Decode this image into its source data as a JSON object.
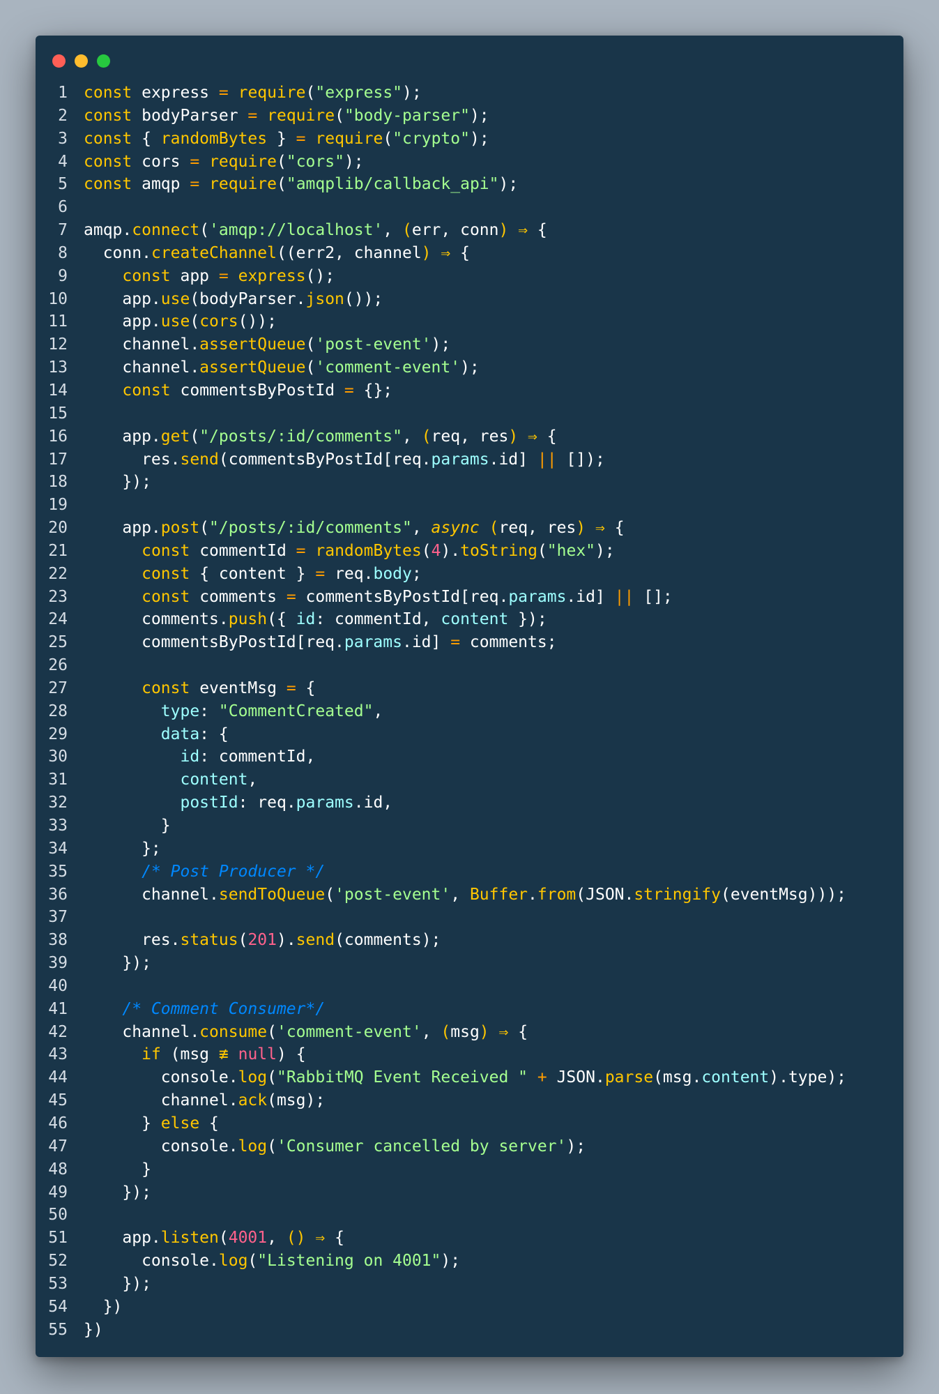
{
  "window": {
    "dot_colors": [
      "#ff5f56",
      "#ffbd2e",
      "#27c93f"
    ]
  },
  "theme": {
    "background": "#193549",
    "keyword": "#ffc600",
    "string": "#a5ff90",
    "property": "#9effff",
    "number": "#ff628c",
    "operator": "#ff9d00",
    "comment": "#0088ff"
  },
  "lines": [
    [
      [
        "k",
        "const"
      ],
      [
        "w",
        " express "
      ],
      [
        "o",
        "="
      ],
      [
        "w",
        " "
      ],
      [
        "f",
        "require"
      ],
      [
        "w",
        "("
      ],
      [
        "s",
        "\"express\""
      ],
      [
        "w",
        ");"
      ]
    ],
    [
      [
        "k",
        "const"
      ],
      [
        "w",
        " bodyParser "
      ],
      [
        "o",
        "="
      ],
      [
        "w",
        " "
      ],
      [
        "f",
        "require"
      ],
      [
        "w",
        "("
      ],
      [
        "s",
        "\"body-parser\""
      ],
      [
        "w",
        ");"
      ]
    ],
    [
      [
        "k",
        "const"
      ],
      [
        "w",
        " { "
      ],
      [
        "k",
        "randomBytes"
      ],
      [
        "w",
        " } "
      ],
      [
        "o",
        "="
      ],
      [
        "w",
        " "
      ],
      [
        "f",
        "require"
      ],
      [
        "w",
        "("
      ],
      [
        "s",
        "\"crypto\""
      ],
      [
        "w",
        ");"
      ]
    ],
    [
      [
        "k",
        "const"
      ],
      [
        "w",
        " cors "
      ],
      [
        "o",
        "="
      ],
      [
        "w",
        " "
      ],
      [
        "f",
        "require"
      ],
      [
        "w",
        "("
      ],
      [
        "s",
        "\"cors\""
      ],
      [
        "w",
        ");"
      ]
    ],
    [
      [
        "k",
        "const"
      ],
      [
        "w",
        " amqp "
      ],
      [
        "o",
        "="
      ],
      [
        "w",
        " "
      ],
      [
        "f",
        "require"
      ],
      [
        "w",
        "("
      ],
      [
        "s",
        "\"amqplib/callback_api\""
      ],
      [
        "w",
        ");"
      ]
    ],
    [],
    [
      [
        "w",
        "amqp."
      ],
      [
        "f",
        "connect"
      ],
      [
        "w",
        "("
      ],
      [
        "s",
        "'amqp://localhost'"
      ],
      [
        "w",
        ", "
      ],
      [
        "k",
        "("
      ],
      [
        "w",
        "err, conn"
      ],
      [
        "k",
        ")"
      ],
      [
        "w",
        " "
      ],
      [
        "k",
        "⇒"
      ],
      [
        "w",
        " {"
      ]
    ],
    [
      [
        "w",
        "  conn."
      ],
      [
        "f",
        "createChannel"
      ],
      [
        "w",
        "(("
      ],
      [
        "w",
        "err2, channel"
      ],
      [
        "k",
        ")"
      ],
      [
        "w",
        " "
      ],
      [
        "k",
        "⇒"
      ],
      [
        "w",
        " {"
      ]
    ],
    [
      [
        "w",
        "    "
      ],
      [
        "k",
        "const"
      ],
      [
        "w",
        " app "
      ],
      [
        "o",
        "="
      ],
      [
        "w",
        " "
      ],
      [
        "f",
        "express"
      ],
      [
        "w",
        "();"
      ]
    ],
    [
      [
        "w",
        "    app."
      ],
      [
        "f",
        "use"
      ],
      [
        "w",
        "(bodyParser."
      ],
      [
        "f",
        "json"
      ],
      [
        "w",
        "());"
      ]
    ],
    [
      [
        "w",
        "    app."
      ],
      [
        "f",
        "use"
      ],
      [
        "w",
        "("
      ],
      [
        "f",
        "cors"
      ],
      [
        "w",
        "());"
      ]
    ],
    [
      [
        "w",
        "    channel."
      ],
      [
        "f",
        "assertQueue"
      ],
      [
        "w",
        "("
      ],
      [
        "s",
        "'post-event'"
      ],
      [
        "w",
        ");"
      ]
    ],
    [
      [
        "w",
        "    channel."
      ],
      [
        "f",
        "assertQueue"
      ],
      [
        "w",
        "("
      ],
      [
        "s",
        "'comment-event'"
      ],
      [
        "w",
        ");"
      ]
    ],
    [
      [
        "w",
        "    "
      ],
      [
        "k",
        "const"
      ],
      [
        "w",
        " commentsByPostId "
      ],
      [
        "o",
        "="
      ],
      [
        "w",
        " {};"
      ]
    ],
    [],
    [
      [
        "w",
        "    app."
      ],
      [
        "f",
        "get"
      ],
      [
        "w",
        "("
      ],
      [
        "s",
        "\"/posts/:id/comments\""
      ],
      [
        "w",
        ", "
      ],
      [
        "k",
        "("
      ],
      [
        "w",
        "req, res"
      ],
      [
        "k",
        ")"
      ],
      [
        "w",
        " "
      ],
      [
        "k",
        "⇒"
      ],
      [
        "w",
        " {"
      ]
    ],
    [
      [
        "w",
        "      res."
      ],
      [
        "f",
        "send"
      ],
      [
        "w",
        "(commentsByPostId[req."
      ],
      [
        "p",
        "params"
      ],
      [
        "w",
        ".id] "
      ],
      [
        "o",
        "||"
      ],
      [
        "w",
        " []);"
      ]
    ],
    [
      [
        "w",
        "    });"
      ]
    ],
    [],
    [
      [
        "w",
        "    app."
      ],
      [
        "f",
        "post"
      ],
      [
        "w",
        "("
      ],
      [
        "s",
        "\"/posts/:id/comments\""
      ],
      [
        "w",
        ", "
      ],
      [
        "a",
        "async"
      ],
      [
        "w",
        " "
      ],
      [
        "k",
        "("
      ],
      [
        "w",
        "req, res"
      ],
      [
        "k",
        ")"
      ],
      [
        "w",
        " "
      ],
      [
        "k",
        "⇒"
      ],
      [
        "w",
        " {"
      ]
    ],
    [
      [
        "w",
        "      "
      ],
      [
        "k",
        "const"
      ],
      [
        "w",
        " commentId "
      ],
      [
        "o",
        "="
      ],
      [
        "w",
        " "
      ],
      [
        "f",
        "randomBytes"
      ],
      [
        "w",
        "("
      ],
      [
        "n",
        "4"
      ],
      [
        "w",
        ")."
      ],
      [
        "f",
        "toString"
      ],
      [
        "w",
        "("
      ],
      [
        "s",
        "\"hex\""
      ],
      [
        "w",
        ");"
      ]
    ],
    [
      [
        "w",
        "      "
      ],
      [
        "k",
        "const"
      ],
      [
        "w",
        " { content } "
      ],
      [
        "o",
        "="
      ],
      [
        "w",
        " req."
      ],
      [
        "p",
        "body"
      ],
      [
        "w",
        ";"
      ]
    ],
    [
      [
        "w",
        "      "
      ],
      [
        "k",
        "const"
      ],
      [
        "w",
        " comments "
      ],
      [
        "o",
        "="
      ],
      [
        "w",
        " commentsByPostId[req."
      ],
      [
        "p",
        "params"
      ],
      [
        "w",
        ".id] "
      ],
      [
        "o",
        "||"
      ],
      [
        "w",
        " [];"
      ]
    ],
    [
      [
        "w",
        "      comments."
      ],
      [
        "f",
        "push"
      ],
      [
        "w",
        "({ "
      ],
      [
        "p",
        "id"
      ],
      [
        "w",
        ": commentId, "
      ],
      [
        "p",
        "content"
      ],
      [
        "w",
        " });"
      ]
    ],
    [
      [
        "w",
        "      commentsByPostId[req."
      ],
      [
        "p",
        "params"
      ],
      [
        "w",
        ".id] "
      ],
      [
        "o",
        "="
      ],
      [
        "w",
        " comments;"
      ]
    ],
    [],
    [
      [
        "w",
        "      "
      ],
      [
        "k",
        "const"
      ],
      [
        "w",
        " eventMsg "
      ],
      [
        "o",
        "="
      ],
      [
        "w",
        " {"
      ]
    ],
    [
      [
        "w",
        "        "
      ],
      [
        "p",
        "type"
      ],
      [
        "w",
        ": "
      ],
      [
        "s",
        "\"CommentCreated\""
      ],
      [
        "w",
        ","
      ]
    ],
    [
      [
        "w",
        "        "
      ],
      [
        "p",
        "data"
      ],
      [
        "w",
        ": {"
      ]
    ],
    [
      [
        "w",
        "          "
      ],
      [
        "p",
        "id"
      ],
      [
        "w",
        ": commentId,"
      ]
    ],
    [
      [
        "w",
        "          "
      ],
      [
        "p",
        "content"
      ],
      [
        "w",
        ","
      ]
    ],
    [
      [
        "w",
        "          "
      ],
      [
        "p",
        "postId"
      ],
      [
        "w",
        ": req."
      ],
      [
        "p",
        "params"
      ],
      [
        "w",
        ".id,"
      ]
    ],
    [
      [
        "w",
        "        }"
      ]
    ],
    [
      [
        "w",
        "      };"
      ]
    ],
    [
      [
        "w",
        "      "
      ],
      [
        "c",
        "/* Post Producer */"
      ]
    ],
    [
      [
        "w",
        "      channel."
      ],
      [
        "f",
        "sendToQueue"
      ],
      [
        "w",
        "("
      ],
      [
        "s",
        "'post-event'"
      ],
      [
        "w",
        ", "
      ],
      [
        "k",
        "Buffer"
      ],
      [
        "w",
        "."
      ],
      [
        "f",
        "from"
      ],
      [
        "w",
        "(JSON."
      ],
      [
        "f",
        "stringify"
      ],
      [
        "w",
        "(eventMsg)));"
      ]
    ],
    [],
    [
      [
        "w",
        "      res."
      ],
      [
        "f",
        "status"
      ],
      [
        "w",
        "("
      ],
      [
        "n",
        "201"
      ],
      [
        "w",
        ")."
      ],
      [
        "f",
        "send"
      ],
      [
        "w",
        "(comments);"
      ]
    ],
    [
      [
        "w",
        "    });"
      ]
    ],
    [],
    [
      [
        "w",
        "    "
      ],
      [
        "c",
        "/* Comment Consumer*/"
      ]
    ],
    [
      [
        "w",
        "    channel."
      ],
      [
        "f",
        "consume"
      ],
      [
        "w",
        "("
      ],
      [
        "s",
        "'comment-event'"
      ],
      [
        "w",
        ", "
      ],
      [
        "k",
        "("
      ],
      [
        "w",
        "msg"
      ],
      [
        "k",
        ")"
      ],
      [
        "w",
        " "
      ],
      [
        "k",
        "⇒"
      ],
      [
        "w",
        " {"
      ]
    ],
    [
      [
        "w",
        "      "
      ],
      [
        "k",
        "if"
      ],
      [
        "w",
        " (msg "
      ],
      [
        "k",
        "≢"
      ],
      [
        "w",
        " "
      ],
      [
        "n",
        "null"
      ],
      [
        "w",
        ") {"
      ]
    ],
    [
      [
        "w",
        "        console."
      ],
      [
        "f",
        "log"
      ],
      [
        "w",
        "("
      ],
      [
        "s",
        "\"RabbitMQ Event Received \""
      ],
      [
        "w",
        " "
      ],
      [
        "o",
        "+"
      ],
      [
        "w",
        " JSON."
      ],
      [
        "f",
        "parse"
      ],
      [
        "w",
        "(msg."
      ],
      [
        "p",
        "content"
      ],
      [
        "w",
        ").type);"
      ]
    ],
    [
      [
        "w",
        "        channel."
      ],
      [
        "f",
        "ack"
      ],
      [
        "w",
        "(msg);"
      ]
    ],
    [
      [
        "w",
        "      } "
      ],
      [
        "k",
        "else"
      ],
      [
        "w",
        " {"
      ]
    ],
    [
      [
        "w",
        "        console."
      ],
      [
        "f",
        "log"
      ],
      [
        "w",
        "("
      ],
      [
        "s",
        "'Consumer cancelled by server'"
      ],
      [
        "w",
        ");"
      ]
    ],
    [
      [
        "w",
        "      }"
      ]
    ],
    [
      [
        "w",
        "    });"
      ]
    ],
    [],
    [
      [
        "w",
        "    app."
      ],
      [
        "f",
        "listen"
      ],
      [
        "w",
        "("
      ],
      [
        "n",
        "4001"
      ],
      [
        "w",
        ", "
      ],
      [
        "k",
        "()"
      ],
      [
        "w",
        " "
      ],
      [
        "k",
        "⇒"
      ],
      [
        "w",
        " {"
      ]
    ],
    [
      [
        "w",
        "      console."
      ],
      [
        "f",
        "log"
      ],
      [
        "w",
        "("
      ],
      [
        "s",
        "\"Listening on 4001\""
      ],
      [
        "w",
        ");"
      ]
    ],
    [
      [
        "w",
        "    });"
      ]
    ],
    [
      [
        "w",
        "  })"
      ]
    ],
    [
      [
        "w",
        "})"
      ]
    ]
  ]
}
